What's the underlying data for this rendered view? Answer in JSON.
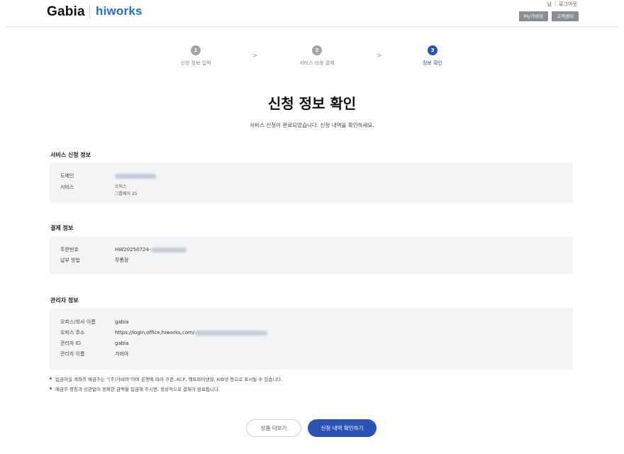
{
  "header": {
    "logo_left": "Gabia",
    "logo_right": "hiworks",
    "user_suffix": "님",
    "logout": "로그아웃",
    "my_gabia": "My가비아",
    "support": "고객센터"
  },
  "steps": [
    {
      "num": "1",
      "label": "신청 정보 입력",
      "state": "done"
    },
    {
      "num": "2",
      "label": "서비스 비용 결제",
      "state": "done"
    },
    {
      "num": "3",
      "label": "정보 확인",
      "state": "active"
    }
  ],
  "step_separator": ">",
  "title": "신청 정보 확인",
  "subtitle": "서비스 신청이 완료되었습니다. 신청 내역을 확인하세요.",
  "service": {
    "title": "서비스 신청 정보",
    "domain_label": "도메인",
    "service_label": "서비스",
    "service_line1": "오피스",
    "service_line2": "그룹웨어 25"
  },
  "payment": {
    "title": "결제 정보",
    "order_label": "주문번호",
    "order_value": "HW20250724-",
    "method_label": "납부 방법",
    "method_value": "무통장"
  },
  "admin": {
    "title": "관리자 정보",
    "office_label": "오피스/회사 이름",
    "office_value": "gabia",
    "address_label": "오피스 주소",
    "address_value": "https://login,office,hiworks,com/",
    "admin_id_label": "관리자 ID",
    "admin_id_value": "gabia",
    "admin_name_label": "관리자 이름",
    "admin_name_value": "가비아"
  },
  "notes": [
    "입금하실 계좌의 예금주는 \"(주)가비아\"이며 은행에 따라 쿠콘, KCP, 헥토파이낸셜, KIB넷 등으로 표시될 수 있습니다.",
    "예금주 명칭과 상관없이 정확한 금액을 입금해 주시면, 정상적으로 결제가 완료됩니다."
  ],
  "buttons": {
    "more_products": "상품 더보기",
    "view_history": "신청 내역 확인하기"
  },
  "colors": {
    "accent": "#2b52b5",
    "brand_hiworks": "#1f6fd6",
    "panel_bg": "#f3f4f6"
  }
}
